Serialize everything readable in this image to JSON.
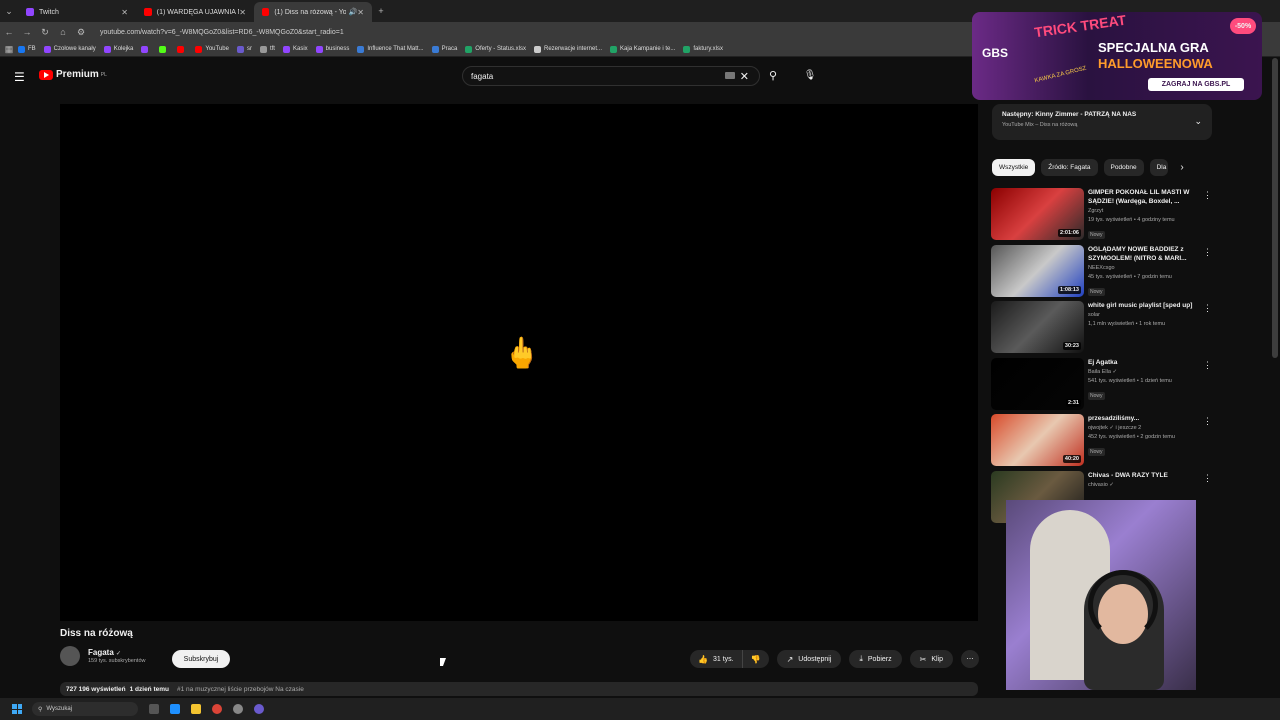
{
  "browser": {
    "tabs": [
      {
        "label": "Twitch",
        "active": false,
        "color": "#9146ff"
      },
      {
        "label": "(1) WARDĘGA UJAWNIA NIEZN",
        "active": false,
        "color": "#ff0000"
      },
      {
        "label": "(1) Diss na różową - YouTu",
        "active": true,
        "color": "#ff0000"
      }
    ],
    "url": "youtube.com/watch?v=6_-W8MQGoZ0&list=RD6_-W8MQGoZ0&start_radio=1",
    "bookmarks": [
      {
        "label": "FB",
        "color": "#1877f2"
      },
      {
        "label": "Czołowe kanały",
        "color": "#9146ff"
      },
      {
        "label": "Kolejka",
        "color": "#9146ff"
      },
      {
        "label": "",
        "color": "#9146ff"
      },
      {
        "label": "",
        "color": "#53fc18"
      },
      {
        "label": "",
        "color": "#ff0000"
      },
      {
        "label": "YouTube",
        "color": "#ff0000"
      },
      {
        "label": "sr",
        "color": "#6a5acd"
      },
      {
        "label": "tft",
        "color": "#999"
      },
      {
        "label": "Kasix",
        "color": "#9146ff"
      },
      {
        "label": "business",
        "color": "#9146ff"
      },
      {
        "label": "Influence That Matt...",
        "color": "#3a7bd5"
      },
      {
        "label": "Praca",
        "color": "#3a7bd5"
      },
      {
        "label": "Oferty - Status.xlsx",
        "color": "#21a366"
      },
      {
        "label": "Rezerwacje internet...",
        "color": "#ccc"
      },
      {
        "label": "Kaja Kampanie i te...",
        "color": "#21a366"
      },
      {
        "label": "faktury.xlsx",
        "color": "#21a366"
      }
    ]
  },
  "youtube": {
    "logo_text": "Premium",
    "logo_country": "PL",
    "search_value": "fagata",
    "player_emoji": "🖕",
    "video_title": "Diss na różową",
    "channel_name": "Fagata",
    "channel_verified": "✓",
    "channel_subs": "159 tys. subskrybentów",
    "subscribe_label": "Subskrybuj",
    "likes_label": "31 tys.",
    "share_label": "Udostępnij",
    "download_label": "Pobierz",
    "clip_label": "Klip",
    "views": "727 196 wyświetleń",
    "date": "1 dzień temu",
    "trending": "#1 na muzycznej liście przebojów Na czasie"
  },
  "ad": {
    "brand": "GBS",
    "trick": "TRICK TREAT",
    "headline1": "SPECJALNA GRA",
    "headline2": "HALLOWEENOWA",
    "cta": "ZAGRAJ NA GBS.PL",
    "badge": "-50%",
    "kawka": "KAWKA ZA GROSZ"
  },
  "up_next": {
    "title": "Następny: Kinny Zimmer - PATRZĄ NA NAS",
    "subtitle": "YouTube Mix – Diss na różową"
  },
  "chips": [
    "Wszystkie",
    "Źródło: Fagata",
    "Podobne",
    "Dla"
  ],
  "videos": [
    {
      "title": "GIMPER POKONAŁ LIL MASTI W SĄDZIE! (Wardęga, Boxdel, ...",
      "channel": "Zgrzyt",
      "meta": "19 tys. wyświetleń • 4 godziny temu",
      "new": "Nowy",
      "duration": "2:01:06",
      "thumb": "linear-gradient(135deg,#8b0000,#d94040 50%,#2a2a2a)"
    },
    {
      "title": "OGLĄDAMY NOWE BADDIEZ z SZYMOOLEM! (NITRO & MARI...",
      "channel": "NEEXcsgo",
      "meta": "45 tys. wyświetleń • 7 godzin temu",
      "new": "Nowy",
      "duration": "1:08:13",
      "thumb": "linear-gradient(135deg,#555,#c9c9c9 50%,#2040c0)"
    },
    {
      "title": "white girl music playlist [sped up]",
      "channel": "solar",
      "meta": "1,1 mln wyświetleń • 1 rok temu",
      "new": "",
      "duration": "30:23",
      "thumb": "linear-gradient(135deg,#1a1a1a,#5a5a5a 50%,#111)"
    },
    {
      "title": "Ej Agatka",
      "channel": "Baila Ella ✓",
      "meta": "541 tys. wyświetleń • 1 dzień temu",
      "new": "Nowy",
      "duration": "2:31",
      "thumb": "linear-gradient(135deg,#000,#050505)"
    },
    {
      "title": "przesadziliśmy...",
      "channel": "ojwojtek ✓ i jeszcze 2",
      "meta": "452 tys. wyświetleń • 2 godzin temu",
      "new": "Nowy",
      "duration": "40:20",
      "thumb": "linear-gradient(135deg,#d84a2a,#e8c8b0 50%,#c03020)"
    },
    {
      "title": "Chivas - DWA RAZY TYLE",
      "channel": "chivasio ✓",
      "meta": "",
      "new": "",
      "duration": "",
      "thumb": "linear-gradient(135deg,#2a3a20,#6a5a40 50%,#1a1a1a)"
    }
  ],
  "taskbar": {
    "search_placeholder": "Wyszukaj"
  }
}
